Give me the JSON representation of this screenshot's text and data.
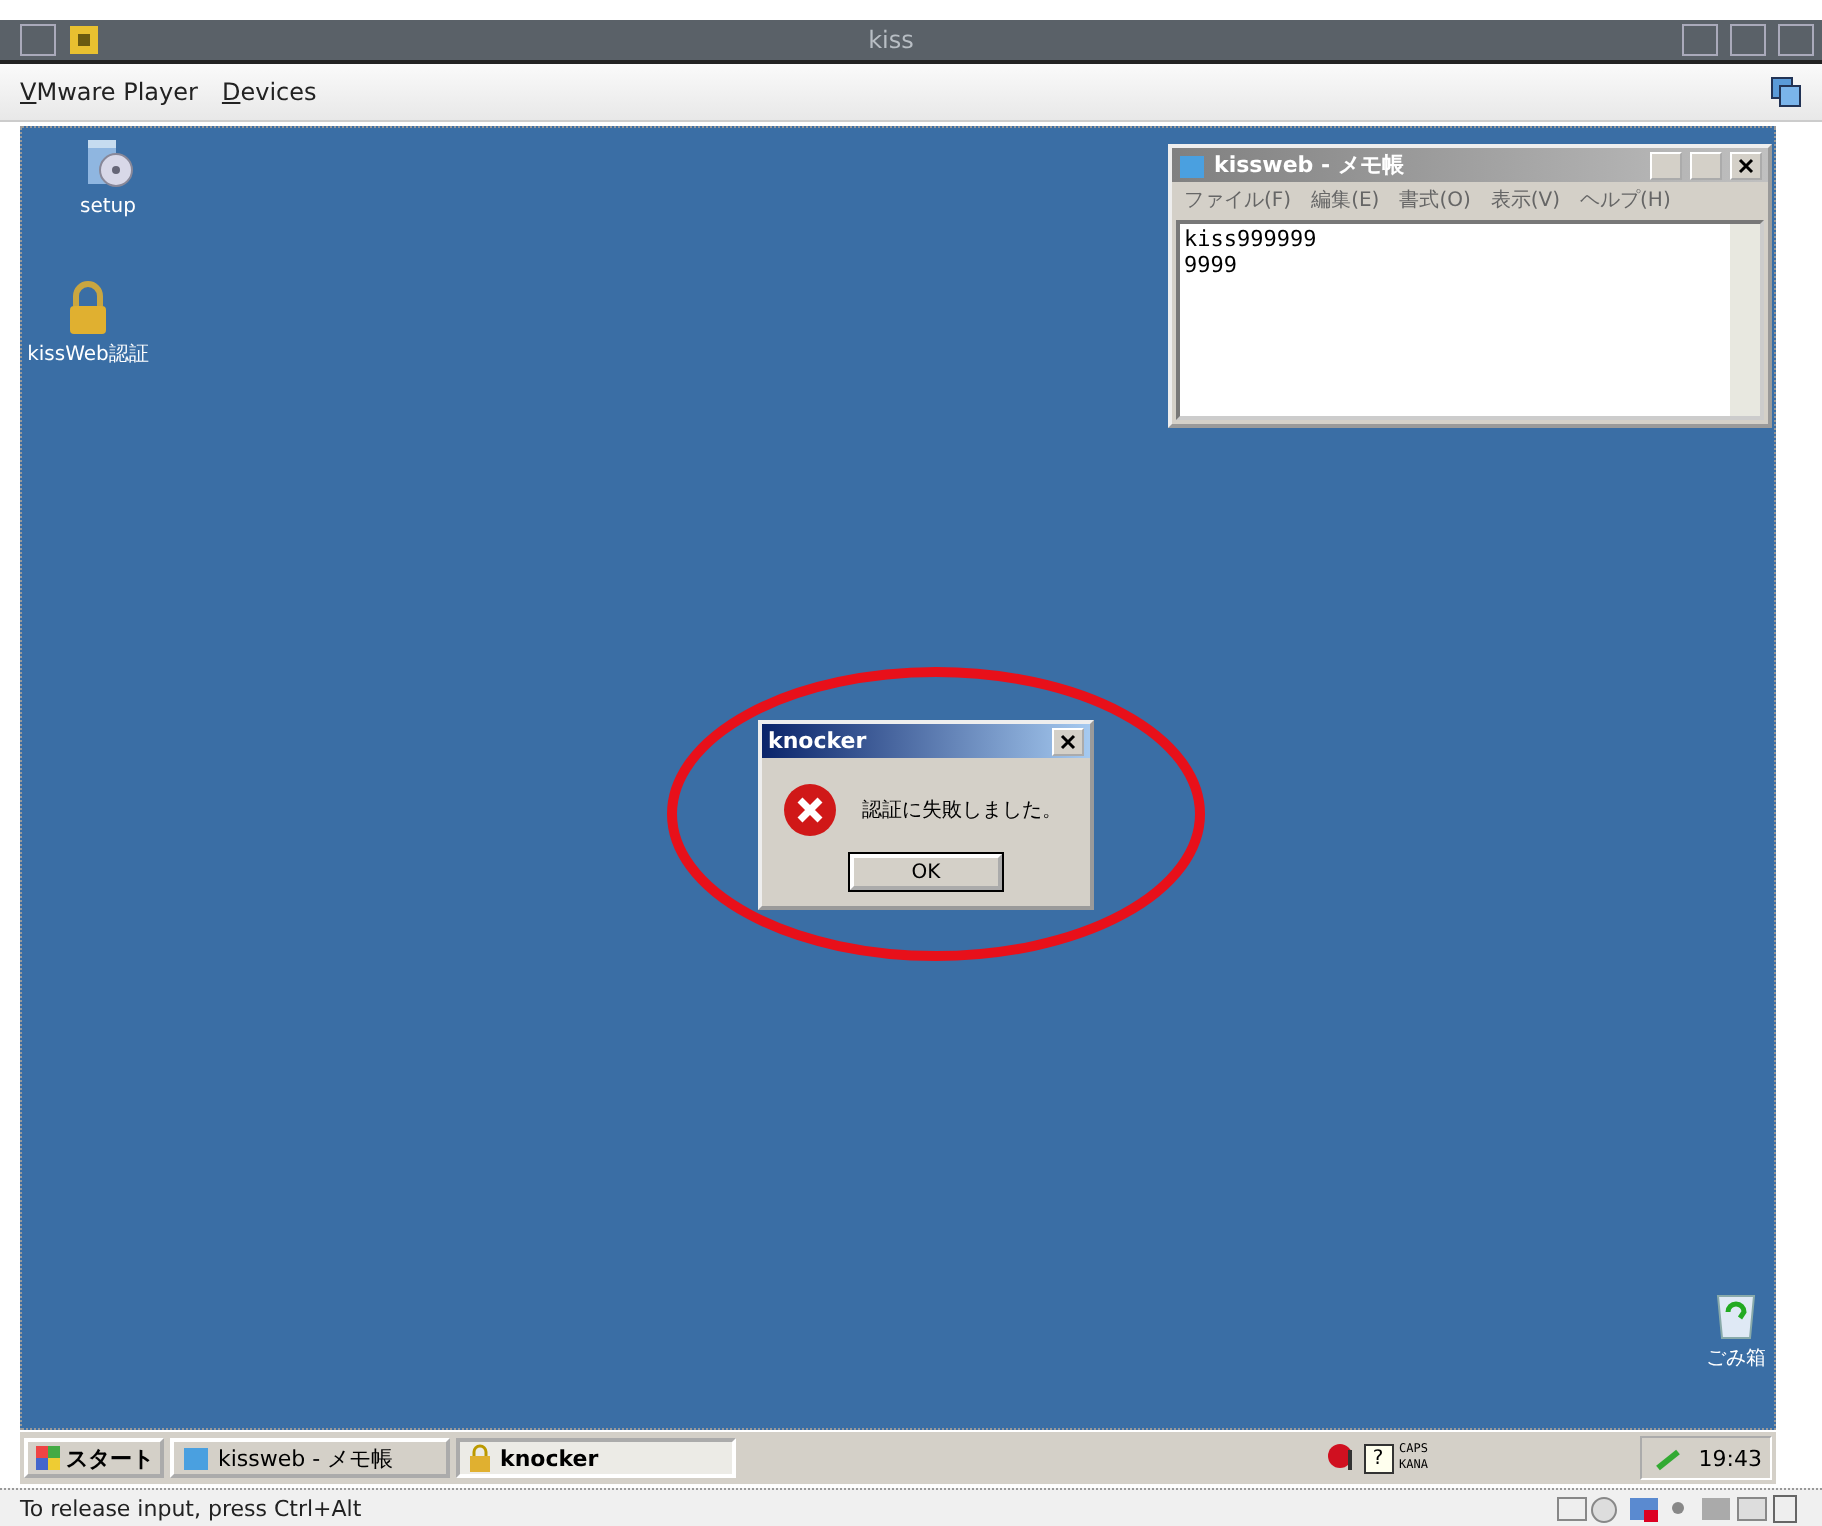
{
  "window": {
    "title": "kiss"
  },
  "menu": [
    {
      "label": "VMware Player"
    },
    {
      "label": "Devices"
    }
  ],
  "desktop_icons": [
    {
      "kind": "setup",
      "label": "setup"
    },
    {
      "kind": "lock",
      "label": "kissWeb認証"
    },
    {
      "kind": "trash",
      "label": "ごみ箱"
    }
  ],
  "notepad": {
    "title": "kissweb - メモ帳",
    "menu": [
      "ファイル(F)",
      "編集(E)",
      "書式(O)",
      "表示(V)",
      "ヘルプ(H)"
    ],
    "lines": [
      "kiss999999",
      "9999"
    ]
  },
  "dialog": {
    "title": "knocker",
    "message": "認証に失敗しました。",
    "button": "OK"
  },
  "annotation": {
    "kind": "ellipse",
    "color": "#e8101a"
  },
  "taskbar": {
    "start": "スタート",
    "tasks": [
      {
        "kind": "notepad",
        "label": "kissweb - メモ帳",
        "selected": false
      },
      {
        "kind": "lock",
        "label": "knocker",
        "selected": true
      }
    ],
    "tray": {
      "help": "?",
      "caps": "CAPS",
      "kana": "KANA"
    },
    "clock": "19:43"
  },
  "status_bar": {
    "text": "To release input, press Ctrl+Alt"
  }
}
